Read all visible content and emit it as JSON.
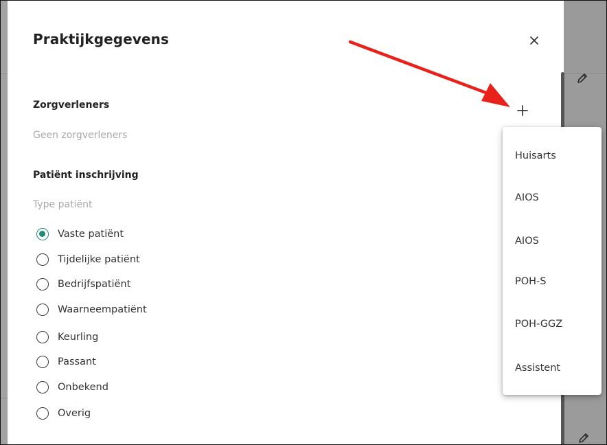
{
  "modal": {
    "title": "Praktijkgegevens",
    "close_symbol": "×"
  },
  "zorgverleners": {
    "heading": "Zorgverleners",
    "empty_text": "Geen zorgverleners",
    "add_symbol": "+"
  },
  "inschrijving": {
    "heading": "Patiënt inschrijving",
    "type_label": "Type patiënt",
    "selected": "Vaste patiënt",
    "options": [
      "Vaste patiënt",
      "Tijdelijke patiënt",
      "Bedrijfspatiënt",
      "Waarneempatiënt",
      "Keurling",
      "Passant",
      "Onbekend",
      "Overig"
    ]
  },
  "dropdown": {
    "items": [
      "Huisarts",
      "AIOS",
      "AIOS",
      "POH-S",
      "POH-GGZ",
      "Assistent"
    ]
  },
  "colors": {
    "accent": "#1f8c76",
    "arrow": "#e8221b",
    "backdrop": "#9b9b9b"
  },
  "icons": {
    "close": "close-icon",
    "add": "plus-icon",
    "edit": "pencil-icon",
    "annotation": "red-arrow"
  }
}
